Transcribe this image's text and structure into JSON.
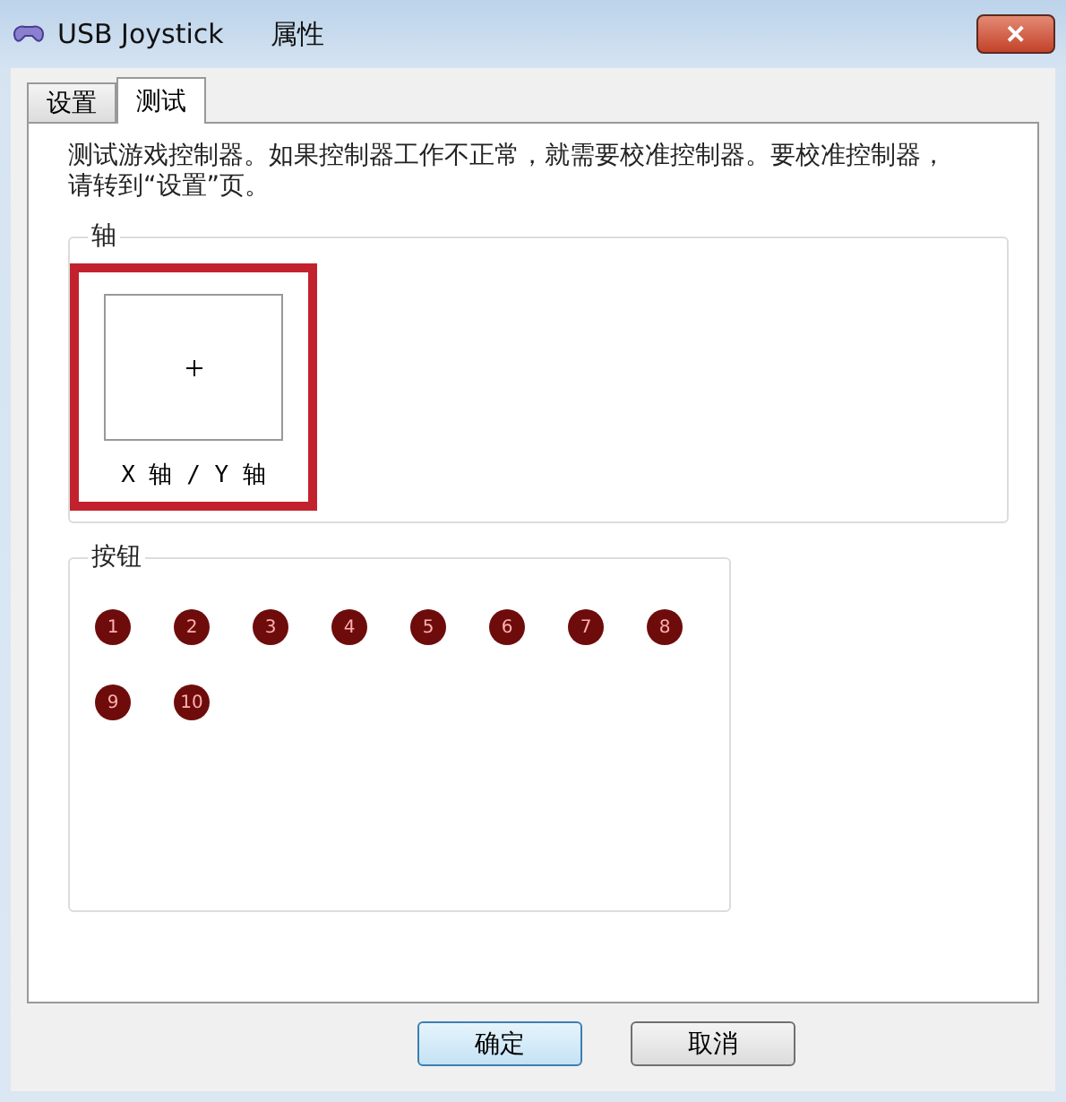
{
  "window": {
    "title": "USB Joystick",
    "subtitle": "属性",
    "close": "✕"
  },
  "tabs": [
    {
      "label": "设置",
      "selected": false
    },
    {
      "label": "测试",
      "selected": true
    }
  ],
  "description": "测试游戏控制器。如果控制器工作不正常，就需要校准控制器。要校准控制器，请转到“设置”页。",
  "axes": {
    "title": "轴",
    "label": "X 轴 / Y 轴",
    "highlighted": true
  },
  "buttons_group": {
    "title": "按钮",
    "buttons": [
      {
        "label": "1",
        "pressed": false
      },
      {
        "label": "2",
        "pressed": false
      },
      {
        "label": "3",
        "pressed": false
      },
      {
        "label": "4",
        "pressed": false
      },
      {
        "label": "5",
        "pressed": false
      },
      {
        "label": "6",
        "pressed": false
      },
      {
        "label": "7",
        "pressed": false
      },
      {
        "label": "8",
        "pressed": false
      },
      {
        "label": "9",
        "pressed": false
      },
      {
        "label": "10",
        "pressed": false
      }
    ]
  },
  "dialog_buttons": [
    {
      "label": "确定",
      "selected": true
    },
    {
      "label": "取消",
      "selected": false
    }
  ]
}
